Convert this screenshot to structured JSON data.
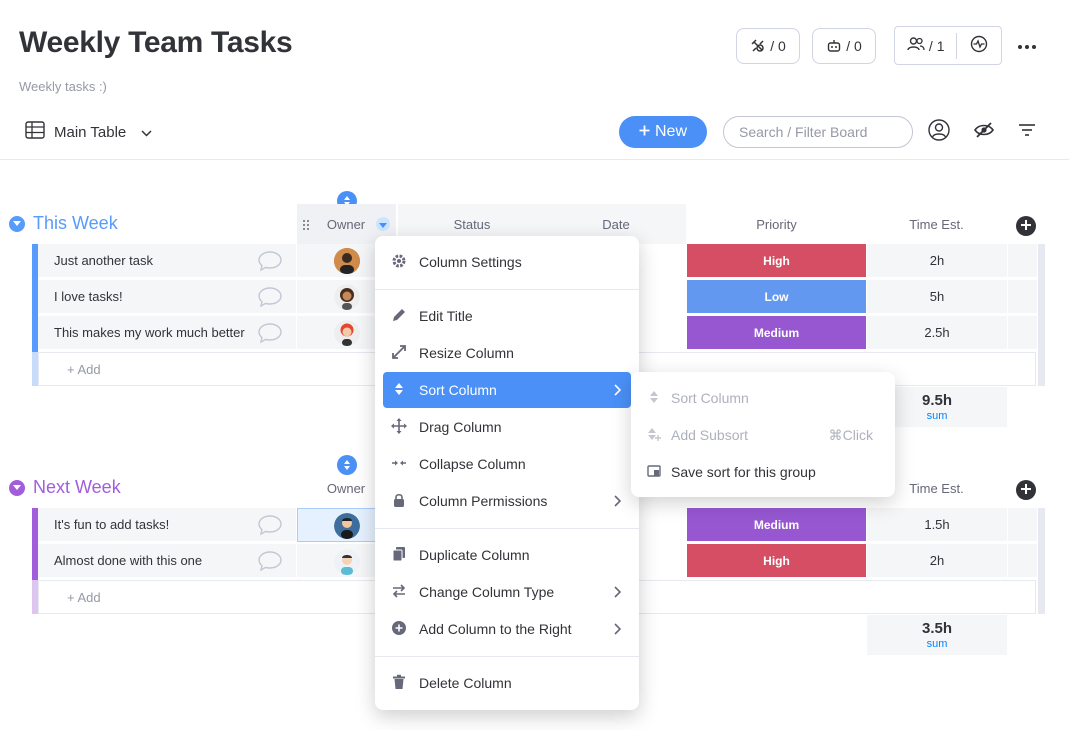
{
  "header": {
    "title": "Weekly Team Tasks",
    "subtitle": "Weekly tasks :)",
    "integrations_count": "/ 0",
    "automations_count": "/ 0",
    "members_count": "/ 1"
  },
  "toolbar": {
    "view_label": "Main Table",
    "new_label": "New",
    "search_placeholder": "Search / Filter Board"
  },
  "columns": {
    "owner": "Owner",
    "status": "Status",
    "date": "Date",
    "priority": "Priority",
    "time_est": "Time Est."
  },
  "colors": {
    "high": "#d64e63",
    "low": "#6298ef",
    "medium": "#9657d1",
    "this_week": "#579bfc",
    "next_week": "#a25ddc"
  },
  "groups": [
    {
      "title": "This Week",
      "tasks": [
        {
          "name": "Just another task",
          "priority": "High",
          "time": "2h"
        },
        {
          "name": "I love tasks!",
          "priority": "Low",
          "time": "5h"
        },
        {
          "name": "This makes my work much better",
          "priority": "Medium",
          "time": "2.5h"
        }
      ],
      "add_label": "+ Add",
      "sum_value": "9.5h",
      "sum_label": "sum"
    },
    {
      "title": "Next Week",
      "tasks": [
        {
          "name": "It's fun to add tasks!",
          "priority": "Medium",
          "time": "1.5h"
        },
        {
          "name": "Almost done with this one",
          "priority": "High",
          "time": "2h"
        }
      ],
      "add_label": "+ Add",
      "sum_value": "3.5h",
      "sum_label": "sum"
    }
  ],
  "column_menu": {
    "items": [
      "Column Settings",
      "Edit Title",
      "Resize Column",
      "Sort Column",
      "Drag Column",
      "Collapse Column",
      "Column Permissions",
      "Duplicate Column",
      "Change Column Type",
      "Add Column to the Right",
      "Delete Column"
    ]
  },
  "sort_submenu": {
    "items": [
      "Sort Column",
      "Add Subsort",
      "Save sort for this group"
    ],
    "shortcut": "⌘Click"
  }
}
